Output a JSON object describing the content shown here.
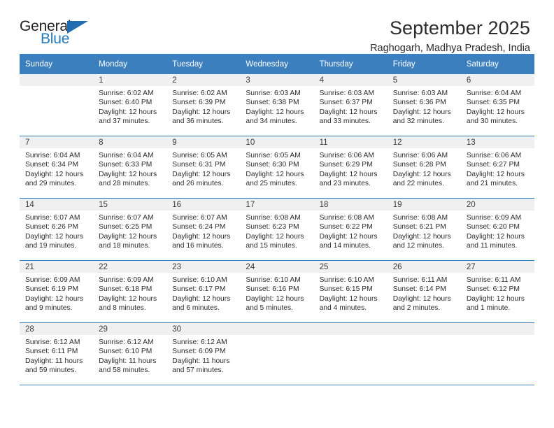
{
  "brand": {
    "name_top": "General",
    "name_bottom": "Blue",
    "accent_color": "#1f6cb0",
    "text_color": "#231f20"
  },
  "header": {
    "month_title": "September 2025",
    "location": "Raghogarh, Madhya Pradesh, India"
  },
  "theme": {
    "header_row_bg": "#3b7fbf",
    "header_row_text": "#ffffff",
    "daynum_bg": "#f0f0f0",
    "grid_line": "#3b7fbf",
    "body_text": "#2c2c2c"
  },
  "calendar": {
    "weekday_headers": [
      "Sunday",
      "Monday",
      "Tuesday",
      "Wednesday",
      "Thursday",
      "Friday",
      "Saturday"
    ],
    "weeks": [
      [
        {
          "day": "",
          "lines": []
        },
        {
          "day": "1",
          "lines": [
            "Sunrise: 6:02 AM",
            "Sunset: 6:40 PM",
            "Daylight: 12 hours",
            "and 37 minutes."
          ]
        },
        {
          "day": "2",
          "lines": [
            "Sunrise: 6:02 AM",
            "Sunset: 6:39 PM",
            "Daylight: 12 hours",
            "and 36 minutes."
          ]
        },
        {
          "day": "3",
          "lines": [
            "Sunrise: 6:03 AM",
            "Sunset: 6:38 PM",
            "Daylight: 12 hours",
            "and 34 minutes."
          ]
        },
        {
          "day": "4",
          "lines": [
            "Sunrise: 6:03 AM",
            "Sunset: 6:37 PM",
            "Daylight: 12 hours",
            "and 33 minutes."
          ]
        },
        {
          "day": "5",
          "lines": [
            "Sunrise: 6:03 AM",
            "Sunset: 6:36 PM",
            "Daylight: 12 hours",
            "and 32 minutes."
          ]
        },
        {
          "day": "6",
          "lines": [
            "Sunrise: 6:04 AM",
            "Sunset: 6:35 PM",
            "Daylight: 12 hours",
            "and 30 minutes."
          ]
        }
      ],
      [
        {
          "day": "7",
          "lines": [
            "Sunrise: 6:04 AM",
            "Sunset: 6:34 PM",
            "Daylight: 12 hours",
            "and 29 minutes."
          ]
        },
        {
          "day": "8",
          "lines": [
            "Sunrise: 6:04 AM",
            "Sunset: 6:33 PM",
            "Daylight: 12 hours",
            "and 28 minutes."
          ]
        },
        {
          "day": "9",
          "lines": [
            "Sunrise: 6:05 AM",
            "Sunset: 6:31 PM",
            "Daylight: 12 hours",
            "and 26 minutes."
          ]
        },
        {
          "day": "10",
          "lines": [
            "Sunrise: 6:05 AM",
            "Sunset: 6:30 PM",
            "Daylight: 12 hours",
            "and 25 minutes."
          ]
        },
        {
          "day": "11",
          "lines": [
            "Sunrise: 6:06 AM",
            "Sunset: 6:29 PM",
            "Daylight: 12 hours",
            "and 23 minutes."
          ]
        },
        {
          "day": "12",
          "lines": [
            "Sunrise: 6:06 AM",
            "Sunset: 6:28 PM",
            "Daylight: 12 hours",
            "and 22 minutes."
          ]
        },
        {
          "day": "13",
          "lines": [
            "Sunrise: 6:06 AM",
            "Sunset: 6:27 PM",
            "Daylight: 12 hours",
            "and 21 minutes."
          ]
        }
      ],
      [
        {
          "day": "14",
          "lines": [
            "Sunrise: 6:07 AM",
            "Sunset: 6:26 PM",
            "Daylight: 12 hours",
            "and 19 minutes."
          ]
        },
        {
          "day": "15",
          "lines": [
            "Sunrise: 6:07 AM",
            "Sunset: 6:25 PM",
            "Daylight: 12 hours",
            "and 18 minutes."
          ]
        },
        {
          "day": "16",
          "lines": [
            "Sunrise: 6:07 AM",
            "Sunset: 6:24 PM",
            "Daylight: 12 hours",
            "and 16 minutes."
          ]
        },
        {
          "day": "17",
          "lines": [
            "Sunrise: 6:08 AM",
            "Sunset: 6:23 PM",
            "Daylight: 12 hours",
            "and 15 minutes."
          ]
        },
        {
          "day": "18",
          "lines": [
            "Sunrise: 6:08 AM",
            "Sunset: 6:22 PM",
            "Daylight: 12 hours",
            "and 14 minutes."
          ]
        },
        {
          "day": "19",
          "lines": [
            "Sunrise: 6:08 AM",
            "Sunset: 6:21 PM",
            "Daylight: 12 hours",
            "and 12 minutes."
          ]
        },
        {
          "day": "20",
          "lines": [
            "Sunrise: 6:09 AM",
            "Sunset: 6:20 PM",
            "Daylight: 12 hours",
            "and 11 minutes."
          ]
        }
      ],
      [
        {
          "day": "21",
          "lines": [
            "Sunrise: 6:09 AM",
            "Sunset: 6:19 PM",
            "Daylight: 12 hours",
            "and 9 minutes."
          ]
        },
        {
          "day": "22",
          "lines": [
            "Sunrise: 6:09 AM",
            "Sunset: 6:18 PM",
            "Daylight: 12 hours",
            "and 8 minutes."
          ]
        },
        {
          "day": "23",
          "lines": [
            "Sunrise: 6:10 AM",
            "Sunset: 6:17 PM",
            "Daylight: 12 hours",
            "and 6 minutes."
          ]
        },
        {
          "day": "24",
          "lines": [
            "Sunrise: 6:10 AM",
            "Sunset: 6:16 PM",
            "Daylight: 12 hours",
            "and 5 minutes."
          ]
        },
        {
          "day": "25",
          "lines": [
            "Sunrise: 6:10 AM",
            "Sunset: 6:15 PM",
            "Daylight: 12 hours",
            "and 4 minutes."
          ]
        },
        {
          "day": "26",
          "lines": [
            "Sunrise: 6:11 AM",
            "Sunset: 6:14 PM",
            "Daylight: 12 hours",
            "and 2 minutes."
          ]
        },
        {
          "day": "27",
          "lines": [
            "Sunrise: 6:11 AM",
            "Sunset: 6:12 PM",
            "Daylight: 12 hours",
            "and 1 minute."
          ]
        }
      ],
      [
        {
          "day": "28",
          "lines": [
            "Sunrise: 6:12 AM",
            "Sunset: 6:11 PM",
            "Daylight: 11 hours",
            "and 59 minutes."
          ]
        },
        {
          "day": "29",
          "lines": [
            "Sunrise: 6:12 AM",
            "Sunset: 6:10 PM",
            "Daylight: 11 hours",
            "and 58 minutes."
          ]
        },
        {
          "day": "30",
          "lines": [
            "Sunrise: 6:12 AM",
            "Sunset: 6:09 PM",
            "Daylight: 11 hours",
            "and 57 minutes."
          ]
        },
        {
          "day": "",
          "lines": []
        },
        {
          "day": "",
          "lines": []
        },
        {
          "day": "",
          "lines": []
        },
        {
          "day": "",
          "lines": []
        }
      ]
    ]
  }
}
